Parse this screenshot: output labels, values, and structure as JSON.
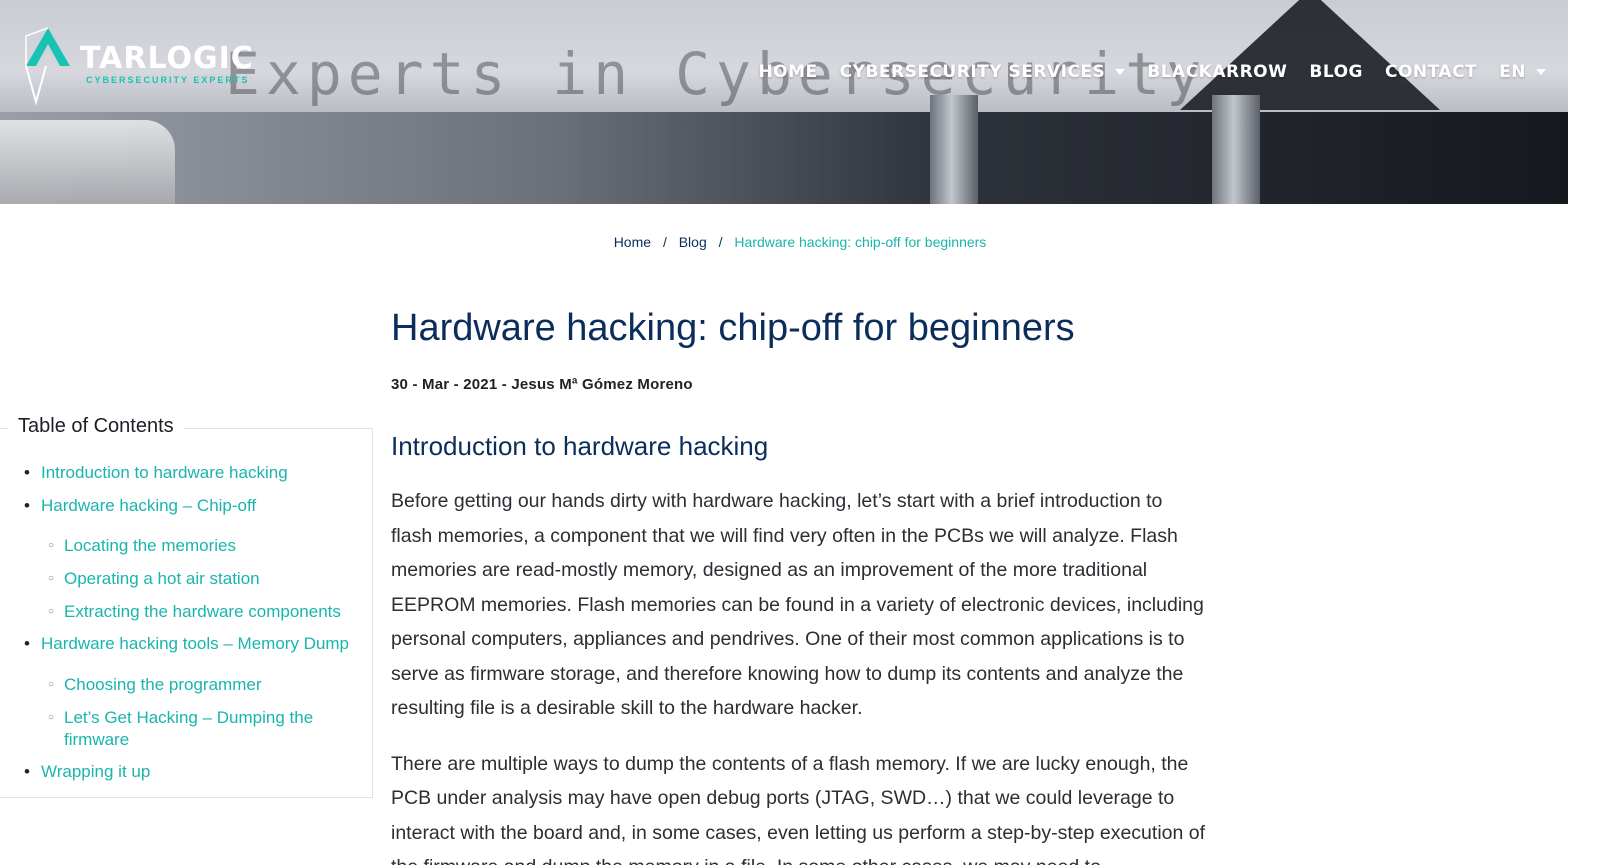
{
  "header": {
    "logo": {
      "brand": "TARLOGIC",
      "tagline": "CYBERSECURITY EXPERTS"
    },
    "hero_text": "Experts in Cybersecurity",
    "nav": [
      {
        "label": "HOME",
        "has_dropdown": false
      },
      {
        "label": "CYBERSECURITY SERVICES",
        "has_dropdown": true
      },
      {
        "label": "BLACKARROW",
        "has_dropdown": false
      },
      {
        "label": "BLOG",
        "has_dropdown": false
      },
      {
        "label": "CONTACT",
        "has_dropdown": false
      },
      {
        "label": "EN",
        "has_dropdown": true
      }
    ],
    "colors": {
      "accent": "#19b5ac",
      "title": "#0b2d5c"
    }
  },
  "breadcrumb": {
    "home": "Home",
    "blog": "Blog",
    "separator": "/",
    "current": "Hardware hacking: chip-off for beginners"
  },
  "toc": {
    "title": "Table of Contents",
    "items": [
      {
        "label": "Introduction to hardware hacking"
      },
      {
        "label": "Hardware hacking – Chip-off",
        "children": [
          "Locating the memories",
          "Operating a hot air station",
          "Extracting the hardware components"
        ]
      },
      {
        "label": "Hardware hacking tools – Memory Dump",
        "children": [
          "Choosing the programmer",
          "Let’s Get Hacking – Dumping the firmware"
        ]
      },
      {
        "label": "Wrapping it up"
      }
    ]
  },
  "article": {
    "title": "Hardware hacking: chip-off for beginners",
    "meta": "30 - Mar - 2021 - Jesus Mª Gómez Moreno",
    "section_heading": "Introduction to hardware hacking",
    "paragraph_1": "Before getting our hands dirty with hardware hacking, let’s start with a brief introduction to flash memories, a component that we will find very often in the PCBs we will analyze. Flash memories are read-mostly memory, designed as an improvement of the more traditional EEPROM memories. Flash memories can be found in a variety of electronic devices, includ­ing personal computers, appliances and pendrives. One of their most common applications is to serve as firmware storage, and therefore knowing how to dump its contents and ana­lyze the resulting file is a desirable skill to the hardware hacker.",
    "paragraph_2": "There are multiple ways to dump the contents of a flash memory. If we are lucky enough, the PCB under analysis may have open debug ports (JTAG, SWD…) that we could leverage to interact with the board and, in some cases, even letting us perform a step-by-step execu­tion of the firmware and dump the memory in a file. In some other cases, we may need to"
  }
}
